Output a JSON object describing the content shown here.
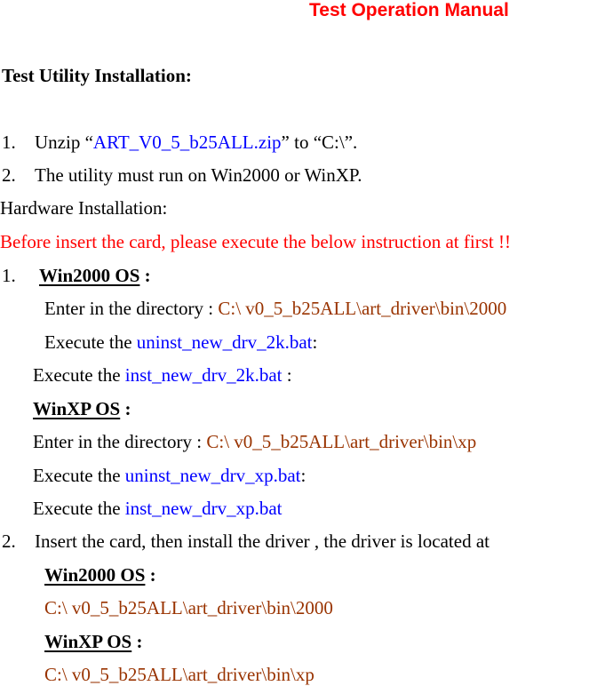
{
  "document": {
    "title": "Test Operation Manual",
    "colors": {
      "title": "#ff0000",
      "filename": "#0000ff",
      "path": "#993300",
      "warning": "#ff0000"
    },
    "utility_section": {
      "heading": "Test Utility Installation:",
      "steps": [
        {
          "num": "1.",
          "pre": "Unzip “",
          "file": "ART_V0_5_b25ALL.zip",
          "post": "” to “C:\\”."
        },
        {
          "num": "2.",
          "text": "The utility must run on Win2000 or WinXP."
        }
      ]
    },
    "hardware_section": {
      "heading": "Hardware Installation:",
      "warning": "Before insert the card, please execute the below instruction at first !!",
      "step1": {
        "num": "1.",
        "win2000": {
          "label": "Win2000 OS",
          "colon": " :",
          "enter_dir_label": "Enter in the directory : ",
          "enter_dir_path": "C:\\ v0_5_b25ALL\\art_driver\\bin\\2000",
          "exec1_label": "Execute the ",
          "exec1_file": "uninst_new_drv_2k.bat",
          "exec1_suffix": ":",
          "exec2_label": "Execute the ",
          "exec2_file": "inst_new_drv_2k.bat",
          "exec2_suffix": " :"
        },
        "winxp": {
          "label": "WinXP OS",
          "colon": " :",
          "enter_dir_label": "Enter in the directory : ",
          "enter_dir_path": "C:\\ v0_5_b25ALL\\art_driver\\bin\\xp",
          "exec1_label": "Execute the ",
          "exec1_file": "uninst_new_drv_xp.bat",
          "exec1_suffix": ":",
          "exec2_label": "Execute the ",
          "exec2_file": "inst_new_drv_xp.bat"
        }
      },
      "step2": {
        "num": "2.",
        "text": "Insert the card, then install the driver , the driver is located at",
        "win2000_label": "Win2000 OS",
        "win2000_colon": " :",
        "win2000_path": "C:\\ v0_5_b25ALL\\art_driver\\bin\\2000",
        "winxp_label": "WinXP OS",
        "winxp_colon": " :",
        "winxp_path": "C:\\ v0_5_b25ALL\\art_driver\\bin\\xp"
      }
    }
  }
}
